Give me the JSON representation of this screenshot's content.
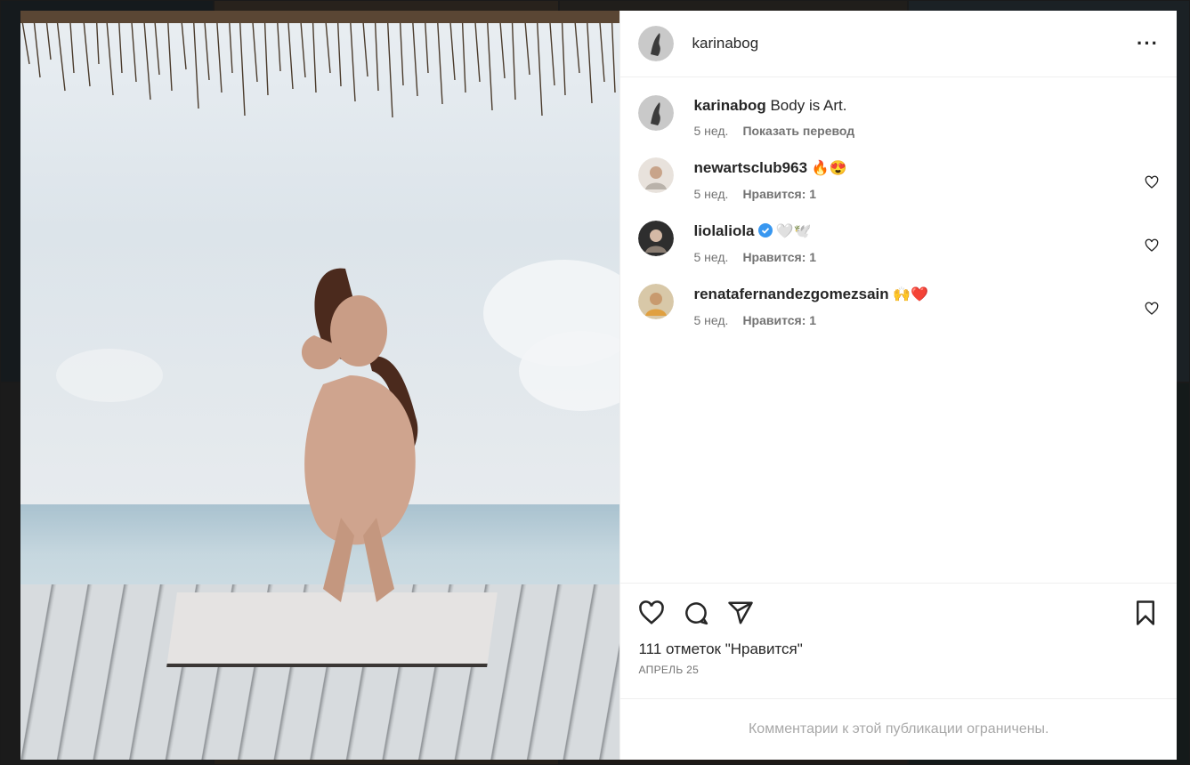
{
  "post": {
    "author": "karinabog",
    "caption_user": "karinabog",
    "caption_text": "Body is Art.",
    "caption_age": "5 нед.",
    "translate_label": "Показать перевод",
    "more_label": "···"
  },
  "comments": [
    {
      "user": "newartsclub963",
      "text": "🔥😍",
      "age": "5 нед.",
      "likes": "Нравится: 1"
    },
    {
      "user": "liolaliola",
      "text": "🤍🕊️",
      "age": "5 нед.",
      "likes": "Нравится: 1"
    },
    {
      "user": "renatafernandezgomezsain",
      "text": "🙌❤️",
      "age": "5 нед.",
      "likes": "Нравится: 1"
    }
  ],
  "footer": {
    "likes_count": "111 отметок \"Нравится\"",
    "date": "АПРЕЛЬ 25",
    "comments_restricted": "Комментарии к этой публикации ограничены."
  },
  "icons": {
    "like": "heart-icon",
    "comment": "comment-icon",
    "share": "share-icon",
    "save": "bookmark-icon",
    "comment_like": "heart-small-icon",
    "verified": "verified-badge-icon"
  },
  "colors": {
    "verified": "#3897f0",
    "text": "#262626",
    "muted": "#737373"
  }
}
